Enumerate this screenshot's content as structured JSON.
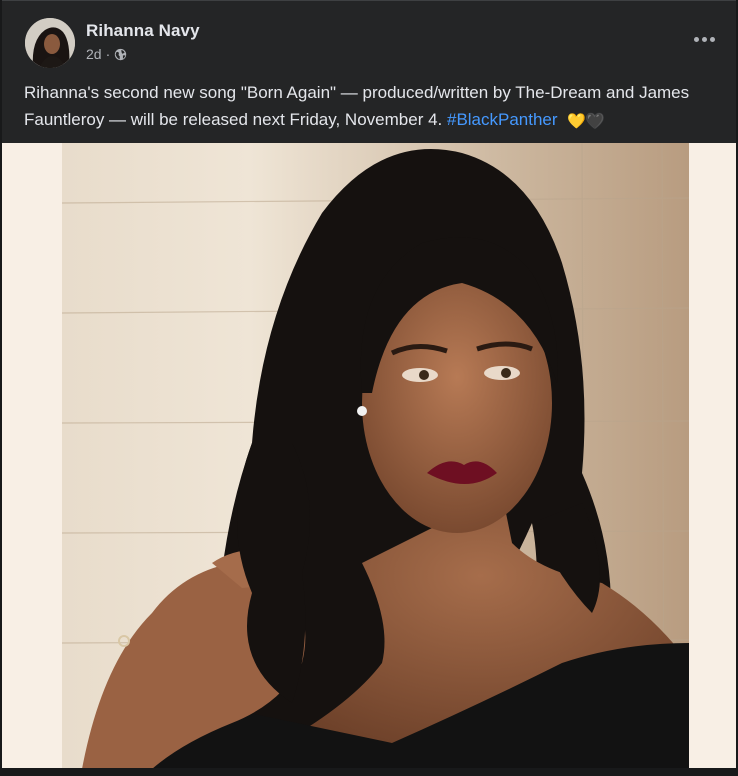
{
  "post": {
    "author": "Rihanna Navy",
    "time": "2d",
    "separator": "·",
    "visibility_icon": "globe-icon",
    "more_icon": "more-options-icon",
    "caption_text": "Rihanna's second new song \"Born Again\" — produced/written by The-Dream and James Fauntleroy — will be released next Friday, November 4. ",
    "hashtag": "#BlackPanther",
    "emojis": [
      "💛",
      "🖤"
    ],
    "colors": {
      "background": "#242526",
      "text": "#e4e6eb",
      "secondary_text": "#b0b3b8",
      "link": "#4599ff",
      "photo_backdrop": "#f8efe5"
    }
  }
}
